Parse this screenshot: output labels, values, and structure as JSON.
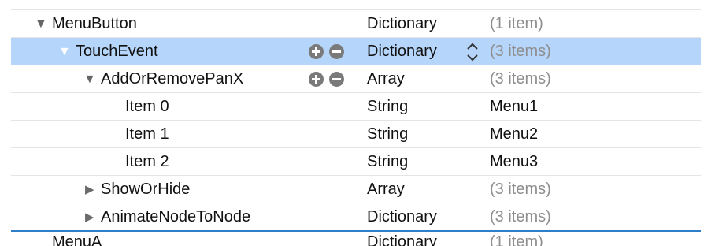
{
  "rows": [
    {
      "key": "MenuButton",
      "type": "Dictionary",
      "value": "(1 item)"
    },
    {
      "key": "TouchEvent",
      "type": "Dictionary",
      "value": "(3 items)"
    },
    {
      "key": "AddOrRemovePanX",
      "type": "Array",
      "value": "(3 items)"
    },
    {
      "key": "Item 0",
      "type": "String",
      "value": "Menu1"
    },
    {
      "key": "Item 1",
      "type": "String",
      "value": "Menu2"
    },
    {
      "key": "Item 2",
      "type": "String",
      "value": "Menu3"
    },
    {
      "key": "ShowOrHide",
      "type": "Array",
      "value": "(3 items)"
    },
    {
      "key": "AnimateNodeToNode",
      "type": "Dictionary",
      "value": "(3 items)"
    }
  ],
  "next_row_partial": {
    "key": "MenuA",
    "type": "Dictionary",
    "value": "(1 item)"
  },
  "icons": {
    "expanded": "disclosure-down-icon",
    "collapsed": "disclosure-right-icon",
    "add": "plus-circle-icon",
    "remove": "minus-circle-icon",
    "type_stepper": "up-down-chevron-icon"
  },
  "colors": {
    "selection": "#b5d5fb",
    "group_separator": "#2f7ec9",
    "muted_value": "#8e8e8e",
    "button_gray": "#7a7a7a"
  }
}
